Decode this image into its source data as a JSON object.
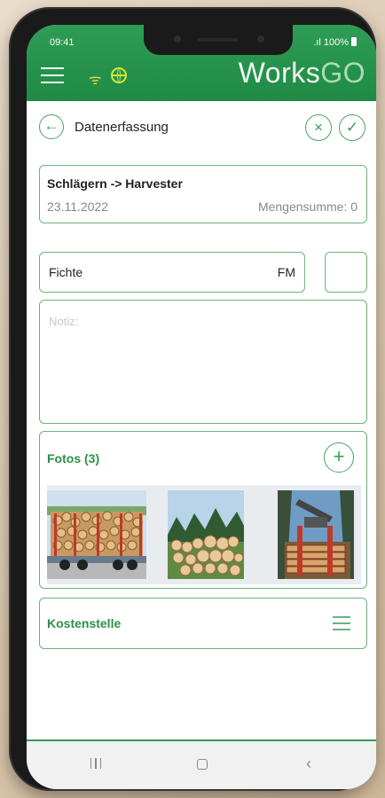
{
  "status": {
    "time": "09:41",
    "battery": "100%"
  },
  "appbar": {
    "brand_main": "Works",
    "brand_accent": "GO",
    "rss_icon": "signal-icon",
    "globe_icon": "globe-icon"
  },
  "header": {
    "title": "Datenerfassung",
    "back_icon": "←",
    "cancel_icon": "×",
    "confirm_icon": "✓"
  },
  "task": {
    "title": "Schlägern -> Harvester",
    "date": "23.11.2022",
    "sum_label": "Mengensumme: 0"
  },
  "entry": {
    "species": "Fichte",
    "unit": "FM",
    "quantity": "",
    "note_placeholder": "Notiz:"
  },
  "photos": {
    "title": "Fotos (3)",
    "add_icon": "+",
    "count": 3
  },
  "cost_center": {
    "label": "Kostenstelle"
  },
  "colors": {
    "primary": "#2e9d55",
    "border": "#6db27d",
    "accent_text": "#2b8f47"
  }
}
